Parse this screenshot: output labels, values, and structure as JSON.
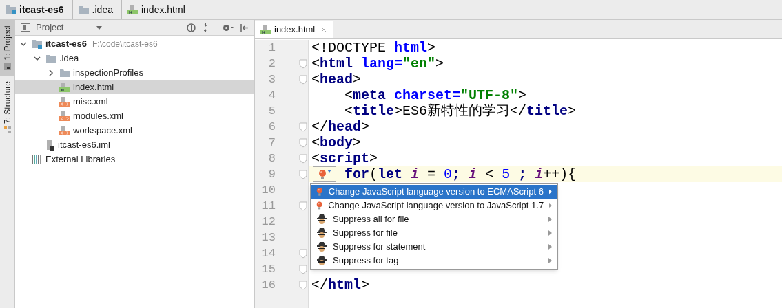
{
  "breadcrumbs": [
    {
      "label": "itcast-es6",
      "kind": "module"
    },
    {
      "label": ".idea",
      "kind": "folder"
    },
    {
      "label": "index.html",
      "kind": "html"
    }
  ],
  "side_tabs": [
    {
      "label": "1: Project",
      "selected": true,
      "kind": "project"
    },
    {
      "label": "7: Structure",
      "selected": false,
      "kind": "structure"
    }
  ],
  "project_panel": {
    "title": "Project"
  },
  "tree": [
    {
      "label": "itcast-es6",
      "hint": "F:\\code\\itcast-es6",
      "kind": "module",
      "bold": true,
      "expanded": true,
      "selected": false,
      "children": [
        {
          "label": ".idea",
          "kind": "folder",
          "bold": false,
          "expanded": true,
          "selected": false,
          "children": [
            {
              "label": "inspectionProfiles",
              "kind": "folder",
              "bold": false,
              "expanded": false,
              "selected": false
            },
            {
              "label": "index.html",
              "kind": "html",
              "bold": false,
              "selected": true
            },
            {
              "label": "misc.xml",
              "kind": "xml",
              "bold": false,
              "selected": false
            },
            {
              "label": "modules.xml",
              "kind": "xml",
              "bold": false,
              "selected": false
            },
            {
              "label": "workspace.xml",
              "kind": "xml",
              "bold": false,
              "selected": false
            }
          ]
        },
        {
          "label": "itcast-es6.iml",
          "kind": "iml",
          "bold": false,
          "selected": false
        }
      ]
    },
    {
      "label": "External Libraries",
      "kind": "library",
      "bold": false,
      "selected": false
    }
  ],
  "editor_tabs": [
    {
      "label": "index.html",
      "selected": true
    }
  ],
  "code_lines": [
    {
      "number": "1",
      "fold": false,
      "indented": false,
      "highlighted": false,
      "tokens": [
        {
          "text": "<!DOCTYPE ",
          "kind": "text"
        },
        {
          "text": "html",
          "kind": "attr"
        },
        {
          "text": ">",
          "kind": "text"
        }
      ]
    },
    {
      "number": "2",
      "fold": true,
      "indented": false,
      "highlighted": false,
      "tokens": [
        {
          "text": "<",
          "kind": "text"
        },
        {
          "text": "html ",
          "kind": "tag"
        },
        {
          "text": "lang=",
          "kind": "attr"
        },
        {
          "text": "\"en\"",
          "kind": "string"
        },
        {
          "text": ">",
          "kind": "text"
        }
      ]
    },
    {
      "number": "3",
      "fold": true,
      "indented": false,
      "highlighted": false,
      "tokens": [
        {
          "text": "<",
          "kind": "text"
        },
        {
          "text": "head",
          "kind": "tag"
        },
        {
          "text": ">",
          "kind": "text"
        }
      ]
    },
    {
      "number": "4",
      "fold": false,
      "indented": true,
      "highlighted": false,
      "tokens": [
        {
          "text": "<",
          "kind": "text"
        },
        {
          "text": "meta ",
          "kind": "tag"
        },
        {
          "text": "charset=",
          "kind": "attr"
        },
        {
          "text": "\"UTF-8\"",
          "kind": "string"
        },
        {
          "text": ">",
          "kind": "text"
        }
      ]
    },
    {
      "number": "5",
      "fold": false,
      "indented": true,
      "highlighted": false,
      "tokens": [
        {
          "text": "<",
          "kind": "text"
        },
        {
          "text": "title",
          "kind": "tag"
        },
        {
          "text": ">",
          "kind": "text"
        },
        {
          "text": "ES6新特性的学习",
          "kind": "text"
        },
        {
          "text": "</",
          "kind": "text"
        },
        {
          "text": "title",
          "kind": "tag"
        },
        {
          "text": ">",
          "kind": "text"
        }
      ]
    },
    {
      "number": "6",
      "fold": true,
      "indented": false,
      "highlighted": false,
      "tokens": [
        {
          "text": "</",
          "kind": "text"
        },
        {
          "text": "head",
          "kind": "tag"
        },
        {
          "text": ">",
          "kind": "text"
        }
      ]
    },
    {
      "number": "7",
      "fold": true,
      "indented": false,
      "highlighted": false,
      "tokens": [
        {
          "text": "<",
          "kind": "text"
        },
        {
          "text": "body",
          "kind": "tag"
        },
        {
          "text": ">",
          "kind": "text"
        }
      ]
    },
    {
      "number": "8",
      "fold": true,
      "indented": false,
      "highlighted": false,
      "tokens": [
        {
          "text": "<",
          "kind": "text"
        },
        {
          "text": "script",
          "kind": "tag"
        },
        {
          "text": ">",
          "kind": "text"
        }
      ]
    },
    {
      "number": "9",
      "fold": true,
      "indented": true,
      "highlighted": true,
      "tokens": [
        {
          "text": "for",
          "kind": "keyword"
        },
        {
          "text": "(",
          "kind": "text"
        },
        {
          "text": "let ",
          "kind": "keyword"
        },
        {
          "text": "i",
          "kind": "var"
        },
        {
          "text": " = ",
          "kind": "text"
        },
        {
          "text": "0",
          "kind": "number"
        },
        {
          "text": "; ",
          "kind": "keyword"
        },
        {
          "text": "i",
          "kind": "var"
        },
        {
          "text": " < ",
          "kind": "text"
        },
        {
          "text": "5",
          "kind": "number"
        },
        {
          "text": " ; ",
          "kind": "keyword"
        },
        {
          "text": "i",
          "kind": "var"
        },
        {
          "text": "++){",
          "kind": "text"
        }
      ]
    },
    {
      "number": "10",
      "fold": false,
      "highlighted": false
    },
    {
      "number": "11",
      "fold": true,
      "highlighted": false
    },
    {
      "number": "12",
      "fold": false,
      "highlighted": false
    },
    {
      "number": "13",
      "fold": false,
      "highlighted": false
    },
    {
      "number": "14",
      "fold": true,
      "highlighted": false
    },
    {
      "number": "15",
      "fold": true,
      "highlighted": false
    },
    {
      "number": "16",
      "fold": true,
      "indented": false,
      "highlighted": false,
      "tokens": [
        {
          "text": "</",
          "kind": "text"
        },
        {
          "text": "html",
          "kind": "tag"
        },
        {
          "text": ">",
          "kind": "text"
        }
      ]
    }
  ],
  "intention_menu": [
    {
      "label": "Change JavaScript language version to ECMAScript 6",
      "kind": "bulb",
      "selected": true
    },
    {
      "label": "Change JavaScript language version to JavaScript 1.7",
      "kind": "bulb",
      "selected": false
    },
    {
      "label": "Suppress all for file",
      "kind": "suppress",
      "selected": false
    },
    {
      "label": "Suppress for file",
      "kind": "suppress",
      "selected": false
    },
    {
      "label": "Suppress for statement",
      "kind": "suppress",
      "selected": false
    },
    {
      "label": "Suppress for tag",
      "kind": "suppress",
      "selected": false
    }
  ]
}
